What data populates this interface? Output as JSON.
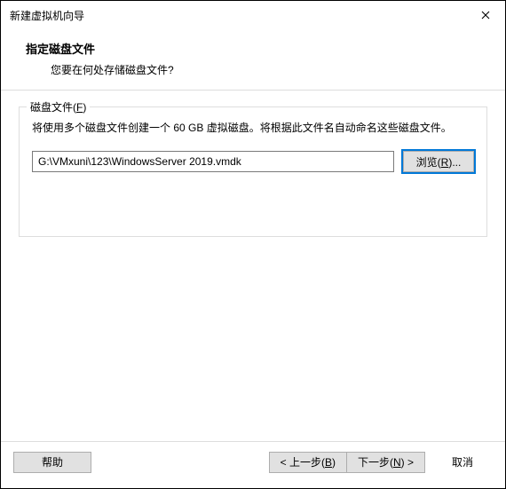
{
  "window": {
    "title": "新建虚拟机向导"
  },
  "header": {
    "title": "指定磁盘文件",
    "subtitle": "您要在何处存储磁盘文件?"
  },
  "fieldset": {
    "legend_prefix": "磁盘文件(",
    "legend_key": "F",
    "legend_suffix": ")",
    "description": "将使用多个磁盘文件创建一个 60 GB 虚拟磁盘。将根据此文件名自动命名这些磁盘文件。",
    "file_path": "G:\\VMxuni\\123\\WindowsServer 2019.vmdk",
    "browse_prefix": "浏览(",
    "browse_key": "R",
    "browse_suffix": ")..."
  },
  "footer": {
    "help": "帮助",
    "back_prefix": "< 上一步(",
    "back_key": "B",
    "back_suffix": ")",
    "next_prefix": "下一步(",
    "next_key": "N",
    "next_suffix": ") >",
    "cancel": "取消"
  }
}
